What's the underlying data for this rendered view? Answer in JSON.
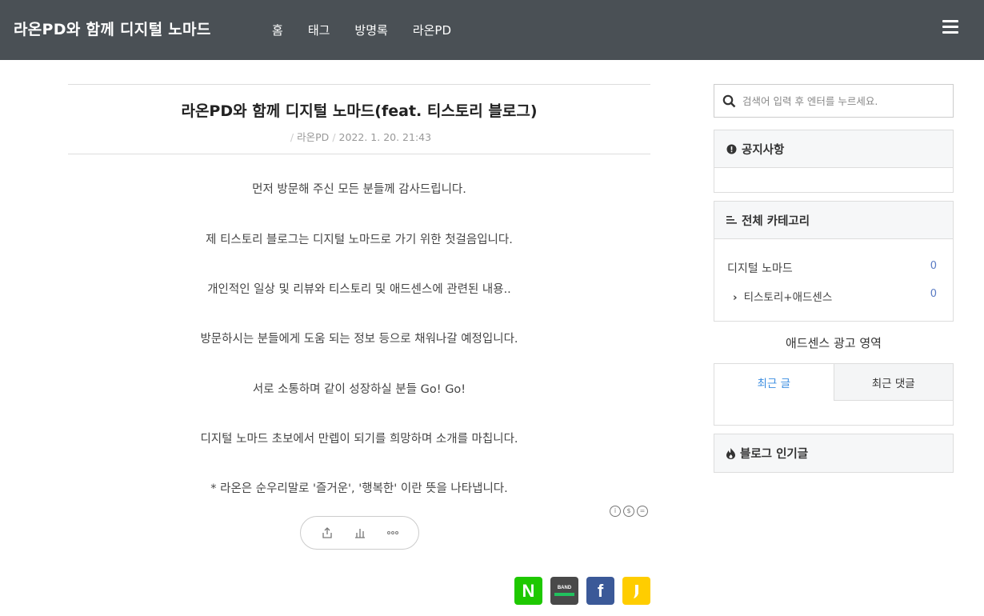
{
  "header": {
    "site_title": "라온PD와 함께 디지털 노마드",
    "nav": [
      "홈",
      "태그",
      "방명록",
      "라온PD"
    ]
  },
  "post": {
    "title": "라온PD와 함께 디지털 노마드(feat. 티스토리 블로그)",
    "author": "라온PD",
    "date": "2022. 1. 20. 21:43",
    "paragraphs": [
      "먼저 방문해 주신 모든 분들께 감사드립니다.",
      "제 티스토리 블로그는 디지털 노마드로 가기 위한 첫걸음입니다.",
      "개인적인 일상 및 리뷰와 티스토리 및 애드센스에 관련된 내용..",
      "방문하시는 분들에게 도움 되는 정보 등으로 채워나갈 예정입니다.",
      "서로 소통하며 같이 성장하실 분들 Go! Go!",
      "디지털 노마드 초보에서 만렙이 되기를 희망하며 소개를 마칩니다.",
      "* 라온은 순우리말로 '즐거운', '행복한' 이란 뜻을 나타냅니다."
    ]
  },
  "sidebar": {
    "search_placeholder": "검색어 입력 후 엔터를 누르세요.",
    "notice_title": "공지사항",
    "category_title": "전체 카테고리",
    "categories": [
      {
        "label": "디지털 노마드",
        "count": "0"
      },
      {
        "label": "티스토리+애드센스",
        "count": "0"
      }
    ],
    "ad_area": "애드센스 광고 영역",
    "tabs": [
      "최근 글",
      "최근 댓글"
    ],
    "popular_title": "블로그 인기글"
  },
  "share": {
    "naver": "N",
    "band": "BAND",
    "facebook": "f"
  },
  "colors": {
    "header_bg": "#4a5055",
    "accent": "#3b8de0",
    "naver": "#1ec800",
    "facebook": "#3b5998",
    "kakao": "#ffcd00"
  }
}
